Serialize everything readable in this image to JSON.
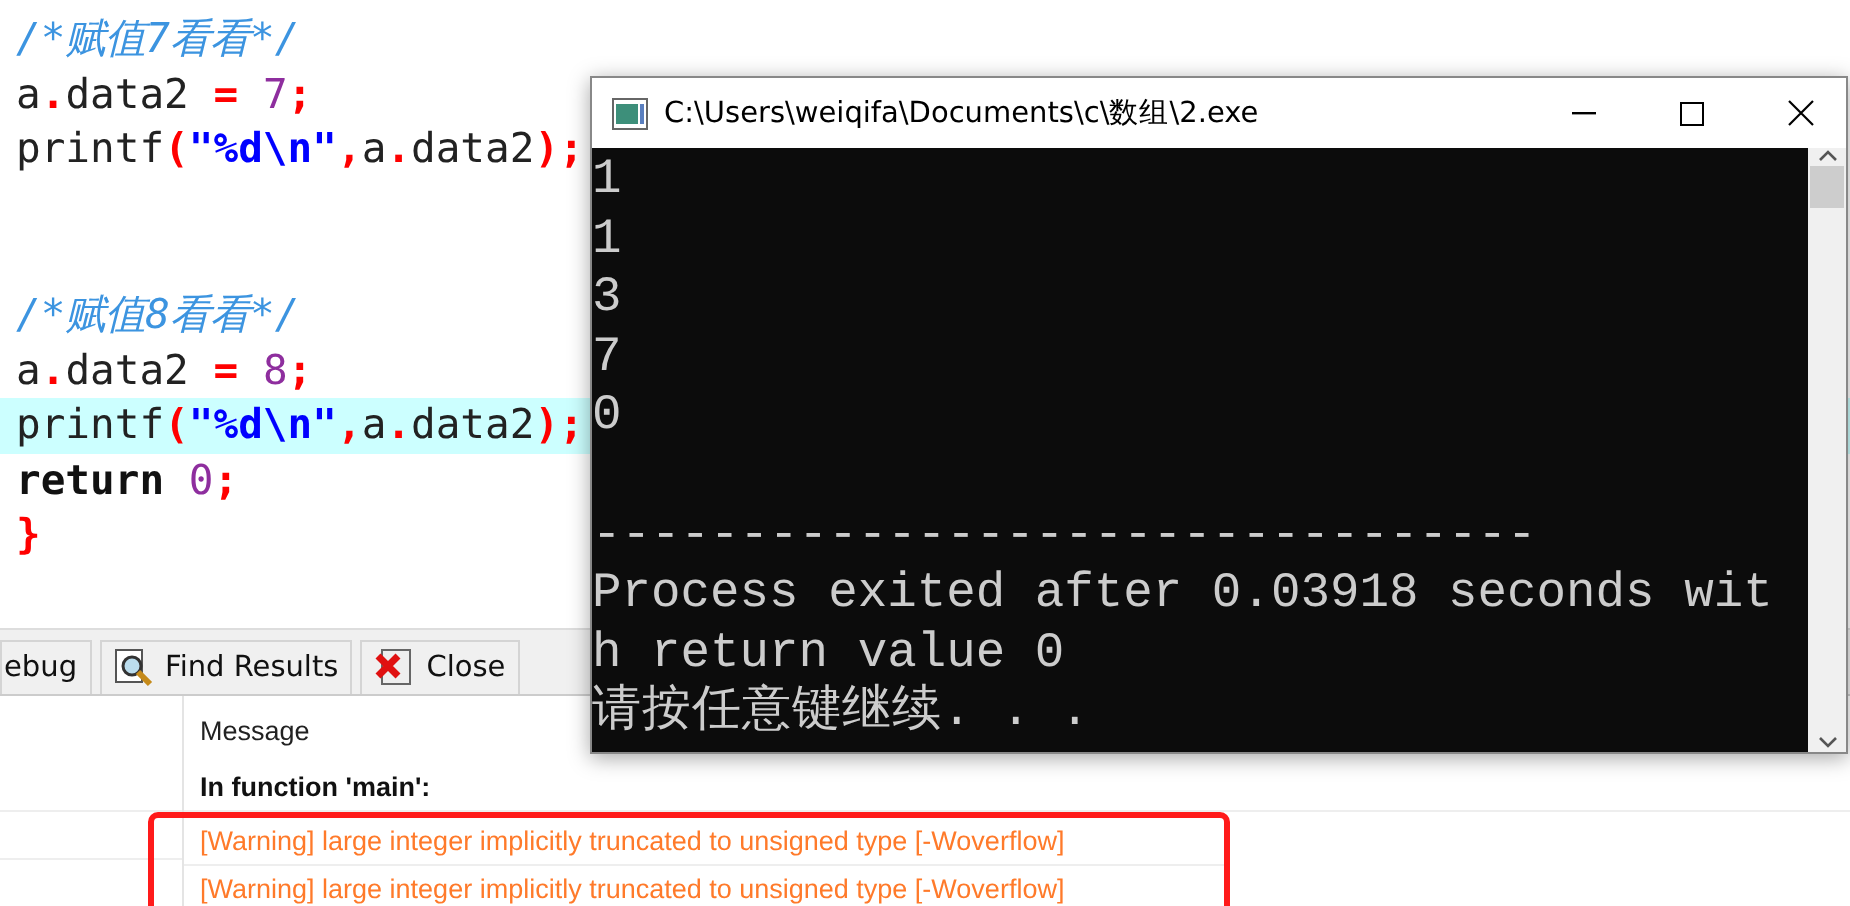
{
  "editor": {
    "lines": [
      {
        "highlighted": false,
        "segments": [
          {
            "kind": "comment",
            "text": "/*赋值7看看*/"
          }
        ]
      },
      {
        "highlighted": false,
        "segments": [
          {
            "kind": "ident",
            "text": "a"
          },
          {
            "kind": "op",
            "text": "."
          },
          {
            "kind": "ident",
            "text": "data2 "
          },
          {
            "kind": "op",
            "text": "= "
          },
          {
            "kind": "number",
            "text": "7"
          },
          {
            "kind": "op",
            "text": ";"
          }
        ]
      },
      {
        "highlighted": false,
        "segments": [
          {
            "kind": "ident",
            "text": "printf"
          },
          {
            "kind": "op",
            "text": "("
          },
          {
            "kind": "string",
            "text": "\"%d\\n\""
          },
          {
            "kind": "op",
            "text": ","
          },
          {
            "kind": "ident",
            "text": "a"
          },
          {
            "kind": "op",
            "text": "."
          },
          {
            "kind": "ident",
            "text": "data2"
          },
          {
            "kind": "op",
            "text": ");"
          }
        ]
      },
      {
        "highlighted": false
      },
      {
        "highlighted": false
      },
      {
        "highlighted": false,
        "segments": [
          {
            "kind": "comment",
            "text": "/*赋值8看看*/"
          }
        ]
      },
      {
        "highlighted": false,
        "segments": [
          {
            "kind": "ident",
            "text": "a"
          },
          {
            "kind": "op",
            "text": "."
          },
          {
            "kind": "ident",
            "text": "data2 "
          },
          {
            "kind": "op",
            "text": "= "
          },
          {
            "kind": "number",
            "text": "8"
          },
          {
            "kind": "op",
            "text": ";"
          }
        ]
      },
      {
        "highlighted": true,
        "segments": [
          {
            "kind": "ident",
            "text": "printf"
          },
          {
            "kind": "op",
            "text": "("
          },
          {
            "kind": "string",
            "text": "\"%d\\n\""
          },
          {
            "kind": "op",
            "text": ","
          },
          {
            "kind": "ident",
            "text": "a"
          },
          {
            "kind": "op",
            "text": "."
          },
          {
            "kind": "ident",
            "text": "data2"
          },
          {
            "kind": "op",
            "text": ");"
          }
        ]
      },
      {
        "highlighted": false,
        "segments": [
          {
            "kind": "keyword",
            "text": "return "
          },
          {
            "kind": "number",
            "text": "0"
          },
          {
            "kind": "op",
            "text": ";"
          }
        ]
      },
      {
        "highlighted": false,
        "segments": [
          {
            "kind": "op",
            "text": "}"
          }
        ]
      }
    ]
  },
  "console": {
    "title": "C:\\Users\\weiqifa\\Documents\\c\\数组\\2.exe",
    "lines": [
      {
        "kind": "output",
        "text": "1"
      },
      {
        "kind": "output",
        "text": "1"
      },
      {
        "kind": "output",
        "text": "3"
      },
      {
        "kind": "output",
        "text": "7"
      },
      {
        "kind": "output",
        "text": "0"
      },
      {
        "kind": "separator",
        "text": "--------------------------------"
      },
      {
        "kind": "output",
        "text": "Process exited after 0.03918 seconds wit"
      },
      {
        "kind": "output",
        "text": "h return value 0"
      },
      {
        "kind": "output",
        "text": "请按任意键继续. . ."
      }
    ]
  },
  "panel": {
    "tabs": [
      {
        "label": "ebug",
        "kind": "plain"
      },
      {
        "label": "Find Results",
        "kind": "find"
      },
      {
        "label": "Close",
        "kind": "close"
      }
    ],
    "header": "Message",
    "messages": [
      {
        "kind": "info",
        "text": "In function 'main':",
        "flagged": false
      },
      {
        "kind": "warning",
        "text": "[Warning] large integer implicitly truncated to unsigned type [-Woverflow]",
        "flagged": true
      },
      {
        "kind": "warning",
        "text": "[Warning] large integer implicitly truncated to unsigned type [-Woverflow]",
        "flagged": true
      }
    ]
  }
}
